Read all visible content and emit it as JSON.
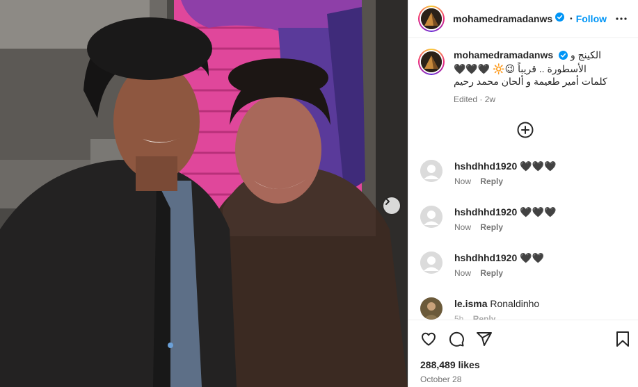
{
  "post": {
    "username": "mohamedramadanws",
    "follow_label": "Follow",
    "separator": "•",
    "caption_line1": "الكينج و",
    "caption_line2": "الأسطورة .. قريباً 😉🔆 🖤🖤🖤",
    "caption_line3": "كلمات أمير طعيمة و ألحان محمد رحيم",
    "caption_meta": "Edited · 2w",
    "likes": "288,489 likes",
    "date": "October 28"
  },
  "comments": [
    {
      "user": "hshdhhd1920",
      "text": "🖤🖤🖤",
      "time": "Now",
      "reply": "Reply"
    },
    {
      "user": "hshdhhd1920",
      "text": "🖤🖤🖤",
      "time": "Now",
      "reply": "Reply"
    },
    {
      "user": "hshdhhd1920",
      "text": "🖤🖤",
      "time": "Now",
      "reply": "Reply"
    },
    {
      "user": "le.isma",
      "text": "Ronaldinho",
      "time": "5h",
      "reply": "Reply"
    }
  ],
  "icons": {
    "verified": "verified-badge-icon",
    "more": "more-options-icon",
    "load_more": "load-more-comments-icon",
    "next": "next-image-icon",
    "like": "heart-icon",
    "comment": "comment-icon",
    "share": "share-icon",
    "save": "bookmark-icon"
  },
  "colors": {
    "accent": "#0095f6",
    "text": "#262626",
    "muted": "#737373",
    "divider": "#efefef"
  }
}
